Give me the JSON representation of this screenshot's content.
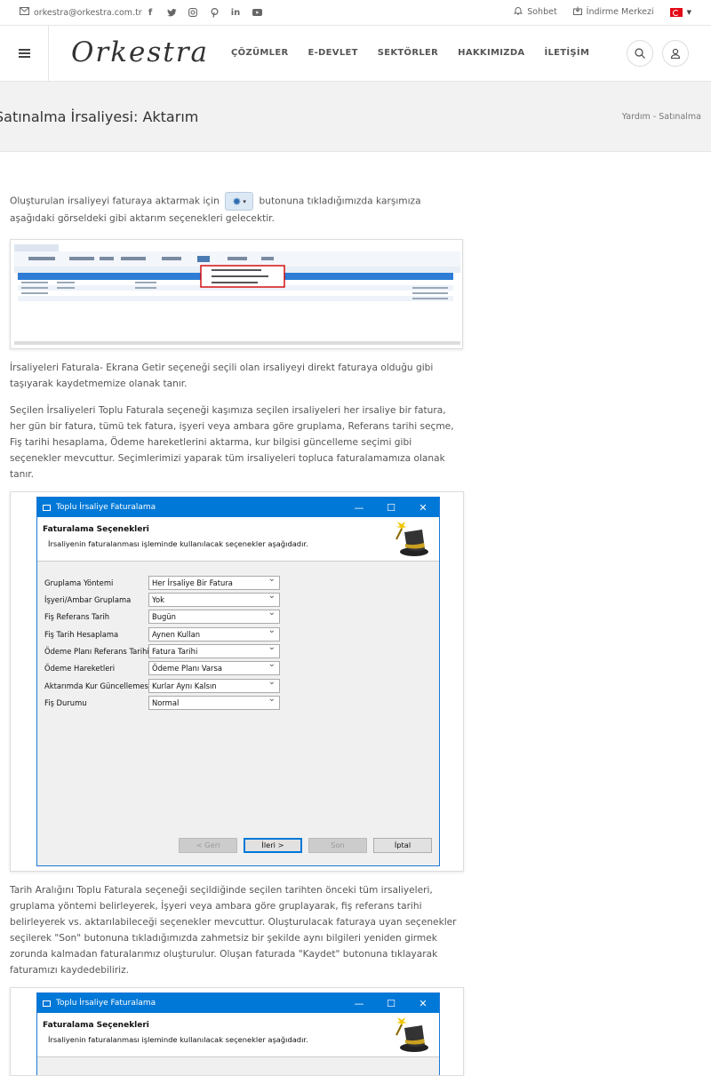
{
  "topbar": {
    "email": "orkestra@orkestra.com.tr",
    "social_icons": [
      "facebook-icon",
      "twitter-icon",
      "instagram-icon",
      "pinterest-icon",
      "linkedin-icon",
      "youtube-icon"
    ],
    "chat_label": "Sohbet",
    "download_label": "İndirme Merkezi"
  },
  "header": {
    "logo": "Orkestra",
    "nav": [
      "ÇÖZÜMLER",
      "E-DEVLET",
      "SEKTÖRLER",
      "HAKKIMIZDA",
      "İLETİŞİM"
    ]
  },
  "page": {
    "title": "Satınalma İrsaliyesi: Aktarım",
    "breadcrumb": "Yardım - Satınalma"
  },
  "content": {
    "p1_before": "Oluşturulan irsaliyeyi faturaya aktarmak için",
    "p1_after": "butonuna tıkladığımızda karşımıza aşağıdaki görseldeki gibi aktarım seçenekleri gelecektir.",
    "p2": "İrsaliyeleri Faturala- Ekrana Getir seçeneği seçili olan irsaliyeyi direkt faturaya olduğu gibi taşıyarak kaydetmemize olanak tanır.",
    "p3": "Seçilen İrsaliyeleri Toplu Faturala seçeneği kaşımıza seçilen irsaliyeleri her irsaliye bir fatura, her gün bir fatura, tümü tek fatura, işyeri veya ambara göre gruplama, Referans tarihi seçme, Fiş tarihi hesaplama, Ödeme hareketlerini aktarma, kur bilgisi güncelleme seçimi gibi seçenekler mevcuttur. Seçimlerimizi yaparak tüm irsaliyeleri topluca faturalamamıza olanak tanır.",
    "p4": "Tarih Aralığını Toplu Faturala seçeneği seçildiğinde seçilen tarihten önceki tüm irsaliyeleri, gruplama yöntemi belirleyerek, İşyeri veya ambara göre gruplayarak, fiş referans tarihi belirleyerek vs. aktarılabileceği seçenekler mevcuttur. Oluşturulacak faturaya uyan seçenekler seçilerek \"Son\" butonuna tıkladığımızda zahmetsiz bir şekilde aynı bilgileri yeniden girmek zorunda kalmadan faturalarımız oluşturulur. Oluşan faturada \"Kaydet\" butonuna tıklayarak faturamızı kaydedebiliriz."
  },
  "dialog": {
    "title": "Toplu İrsaliye Faturalama",
    "heading": "Faturalama Seçenekleri",
    "subheading": "İrsaliyenin faturalanması işleminde kullanılacak seçenekler aşağıdadır.",
    "fields": [
      {
        "label": "Gruplama Yöntemi",
        "value": "Her İrsaliye Bir Fatura"
      },
      {
        "label": "İşyeri/Ambar Gruplama",
        "value": "Yok"
      },
      {
        "label": "Fiş Referans Tarih",
        "value": "Bugün"
      },
      {
        "label": "Fiş Tarih Hesaplama",
        "value": "Aynen Kullan"
      },
      {
        "label": "Ödeme Planı Referans Tarihi",
        "value": "Fatura Tarihi"
      },
      {
        "label": "Ödeme Hareketleri",
        "value": "Ödeme Planı Varsa"
      },
      {
        "label": "Aktarımda Kur Güncellemesi",
        "value": "Kurlar Aynı Kalsın"
      },
      {
        "label": "Fiş Durumu",
        "value": "Normal"
      }
    ],
    "buttons": {
      "back": "< Geri",
      "next": "İleri >",
      "finish": "Son",
      "cancel": "İptal"
    }
  },
  "colors": {
    "titlebar": "#0078d7",
    "accent": "#e30a17"
  }
}
